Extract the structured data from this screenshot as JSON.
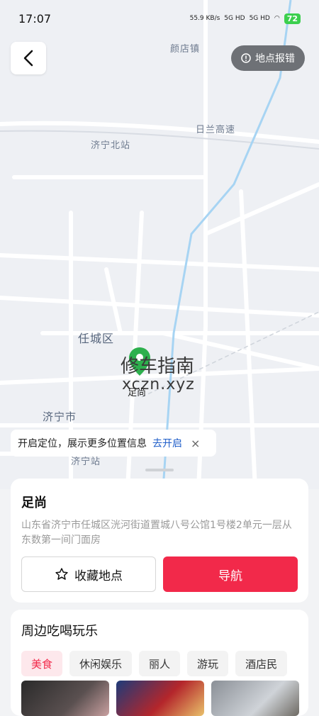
{
  "status": {
    "time": "17:07",
    "net_speed": "55.9 KB/s",
    "signal1": "5G HD",
    "signal2": "5G HD",
    "battery": "72"
  },
  "map": {
    "report_label": "地点报错",
    "labels": {
      "yandian": "颜店镇",
      "rilan": "日兰高速",
      "jining_north": "济宁北站",
      "rencheng": "任城区",
      "jining_city": "济宁市",
      "jining_station": "济宁站"
    },
    "poi_label": "足尚",
    "watermark_cn": "修车指南",
    "watermark_en": "xczn.xyz"
  },
  "location_banner": {
    "text": "开启定位，展示更多位置信息",
    "action": "去开启",
    "close": "×"
  },
  "place": {
    "name": "足尚",
    "address": "山东省济宁市任城区洸河街道置城八号公馆1号楼2单元一层从东数第一间门面房",
    "favorite_label": "收藏地点",
    "navigate_label": "导航"
  },
  "nearby": {
    "title": "周边吃喝玩乐",
    "tabs": [
      "美食",
      "休闲娱乐",
      "丽人",
      "游玩",
      "酒店民"
    ]
  },
  "colors": {
    "accent": "#f2294a",
    "pin": "#2db04d",
    "link": "#1f5ec9"
  }
}
